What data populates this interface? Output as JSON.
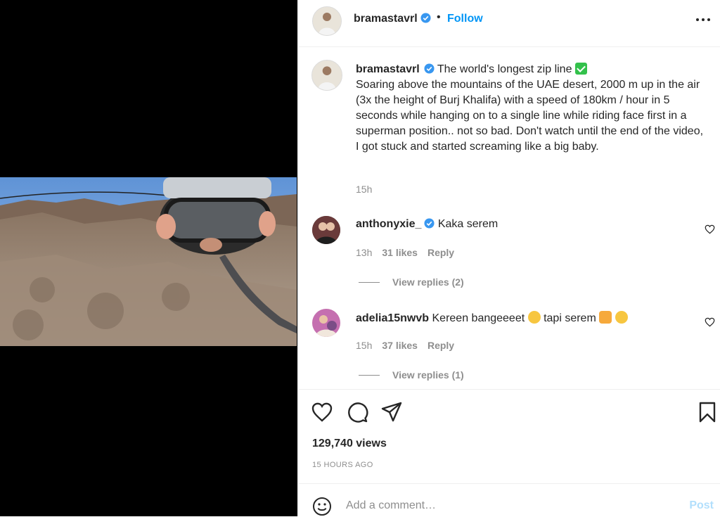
{
  "header": {
    "username": "bramastavrl",
    "separator": "•",
    "follow_label": "Follow"
  },
  "caption": {
    "username": "bramastavrl",
    "title": "The world's longest zip line",
    "body": "Soaring above the mountains of the UAE desert, 2000 m up in the air (3x the height of Burj Khalifa) with a speed of 180km / hour in 5 seconds while hanging on to a single line while riding face first in a superman position.. not so bad. Don't watch until the end of the video, I got stuck and started screaming like a big baby.",
    "time": "15h"
  },
  "comments": [
    {
      "username": "anthonyxie_",
      "text": "Kaka serem",
      "time": "13h",
      "likes": "31 likes",
      "reply_label": "Reply",
      "view_replies": "View replies (2)"
    },
    {
      "username": "adelia15nwvb",
      "text_part1": "Kereen bangeeeet",
      "text_part2": "tapi serem",
      "time": "15h",
      "likes": "37 likes",
      "reply_label": "Reply",
      "view_replies": "View replies (1)"
    }
  ],
  "stats": {
    "views": "129,740 views",
    "posted": "15 HOURS AGO"
  },
  "comment_box": {
    "placeholder": "Add a comment…",
    "post_label": "Post"
  },
  "colors": {
    "accent": "#0095f6",
    "verified": "#3897f0",
    "muted": "#8e8e8e",
    "post_disabled": "#b2dffc"
  }
}
